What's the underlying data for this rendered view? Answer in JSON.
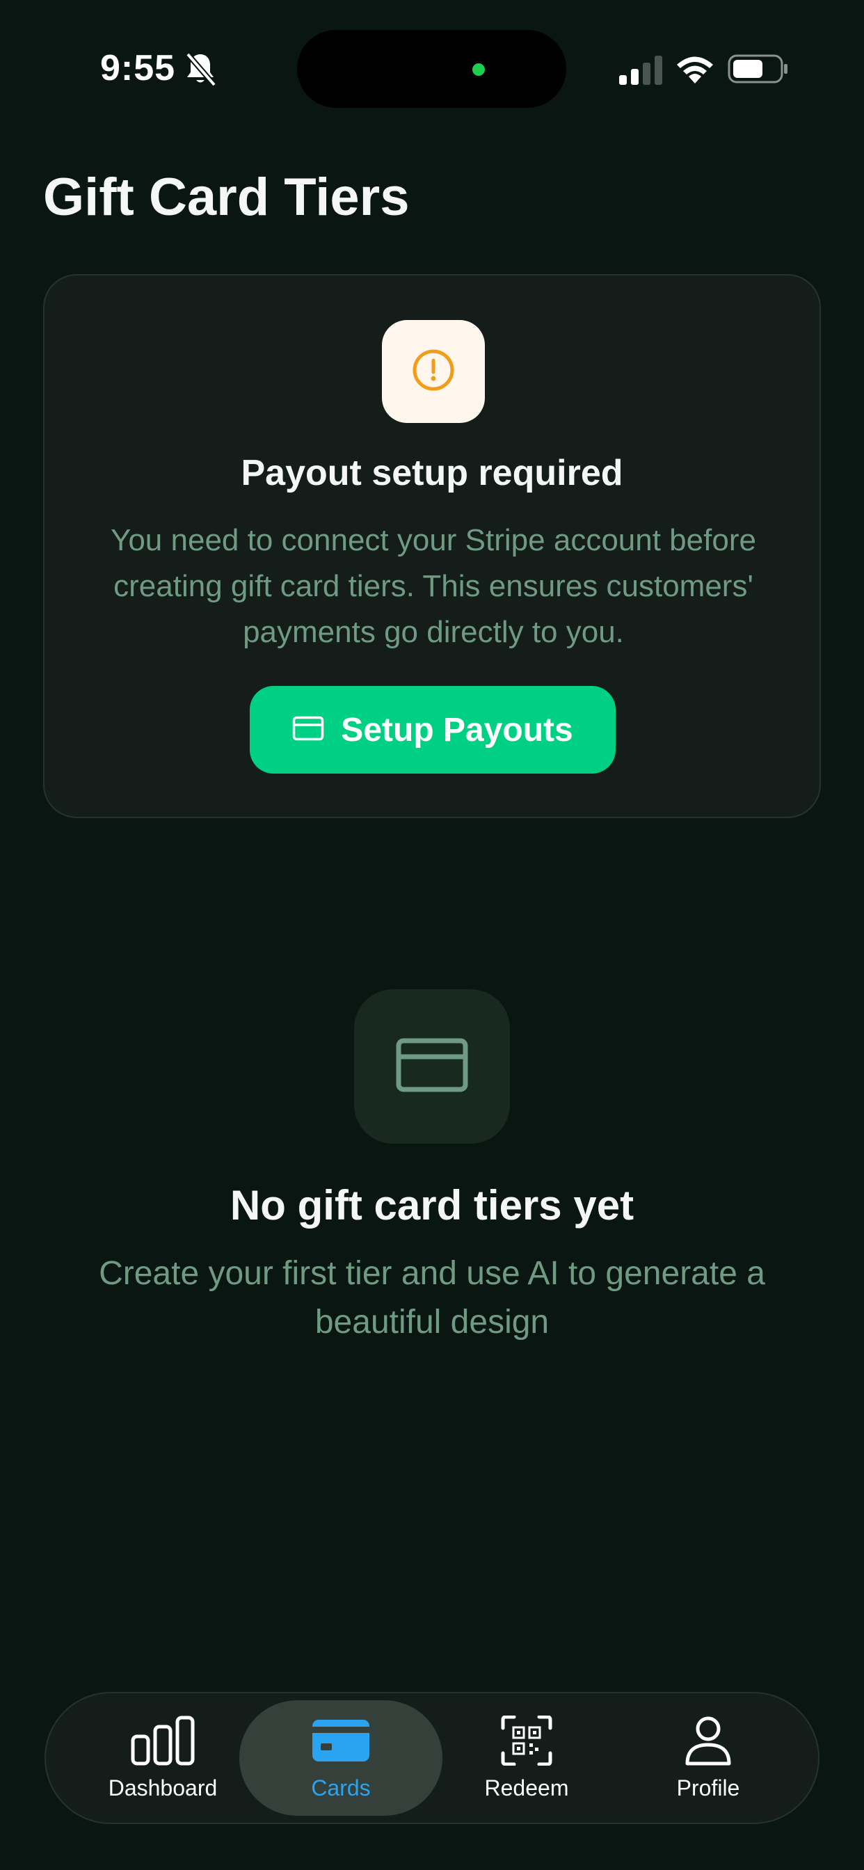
{
  "status_bar": {
    "time": "9:55",
    "icons": [
      "bell-slash-icon",
      "signal-icon",
      "wifi-icon",
      "battery-icon"
    ]
  },
  "page": {
    "title": "Gift Card Tiers"
  },
  "payout_card": {
    "icon": "exclamation-circle-icon",
    "title": "Payout setup required",
    "description": "You need to connect your Stripe account before creating gift card tiers. This ensures customers' payments go directly to you.",
    "button_icon": "credit-card-icon",
    "button_label": "Setup Payouts"
  },
  "empty_state": {
    "icon": "credit-card-icon",
    "title": "No gift card tiers yet",
    "description": "Create your first tier and use AI to generate a beautiful design"
  },
  "tab_bar": {
    "tabs": [
      {
        "label": "Dashboard",
        "icon": "bar-chart-icon",
        "active": false
      },
      {
        "label": "Cards",
        "icon": "credit-card-icon",
        "active": true
      },
      {
        "label": "Redeem",
        "icon": "qr-scan-icon",
        "active": false
      },
      {
        "label": "Profile",
        "icon": "person-icon",
        "active": false
      }
    ]
  },
  "colors": {
    "background": "#0a1611",
    "card": "#141d19",
    "accent_green": "#00d084",
    "muted_text": "#6f9a84",
    "warning": "#f29d1a",
    "active_tab": "#2aa3f0"
  }
}
